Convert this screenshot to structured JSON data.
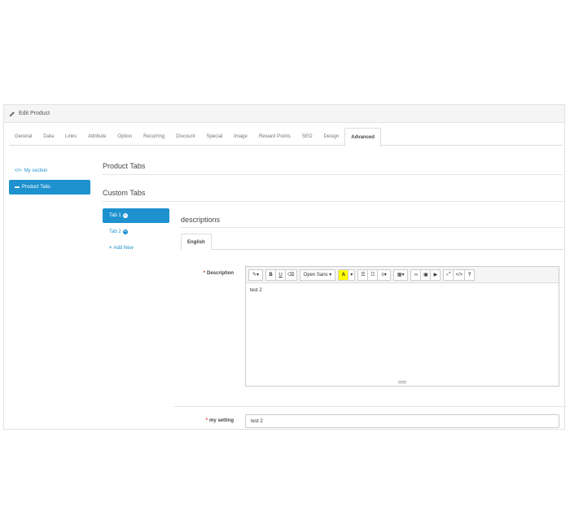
{
  "panel": {
    "title": "Edit Product"
  },
  "tabs": [
    "General",
    "Data",
    "Links",
    "Attribute",
    "Option",
    "Recurring",
    "Discount",
    "Special",
    "Image",
    "Reward Points",
    "SEO",
    "Design",
    "Advanced"
  ],
  "active_tab": "Advanced",
  "left_nav": {
    "items": [
      {
        "label": "My section",
        "icon": "code-icon"
      },
      {
        "label": "Product Tabs",
        "icon": "card-icon"
      }
    ]
  },
  "sections": {
    "product_tabs": "Product Tabs",
    "custom_tabs": "Custom Tabs",
    "descriptions": "descriptions"
  },
  "custom_tabs": {
    "items": [
      {
        "label": "Tab 1",
        "active": true
      },
      {
        "label": "Tab 2",
        "active": false
      }
    ],
    "add_new": "Add New"
  },
  "language_tab": "English",
  "description": {
    "label": "Description",
    "font_select": "Open Sans",
    "content": "test 2"
  },
  "my_setting": {
    "label": "my setting",
    "value": "test 2"
  },
  "colors": {
    "accent": "#1e91cf",
    "required": "#c72f1d"
  }
}
